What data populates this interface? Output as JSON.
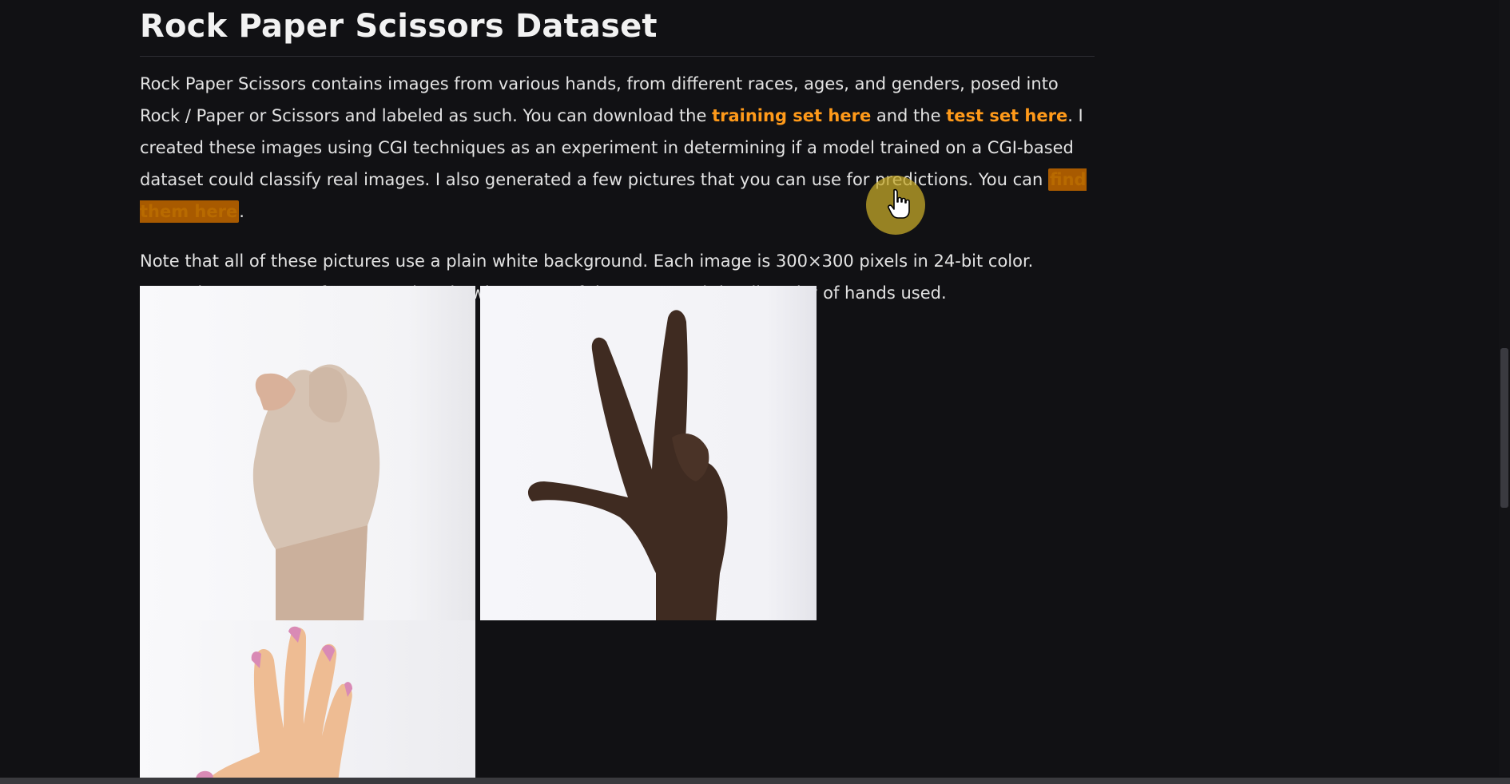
{
  "article": {
    "title": "Rock Paper Scissors Dataset",
    "para1": {
      "text_a": "Rock Paper Scissors contains images from various hands, from different races, ages, and genders, posed into Rock / Paper or Scissors and labeled as such. You can download the ",
      "link_training": "training set here",
      "text_b": " and the ",
      "link_test": "test set here",
      "text_c": ". I created these images using CGI techniques as an experiment in determining if a model trained on a CGI-based dataset could classify real images. I also generated a few pictures that you can use for predictions. You can ",
      "link_find": "find them here",
      "text_d": "."
    },
    "para2": "Note that all of these pictures use a plain white background. Each image is 300×300 pixels in 24-bit color. Examples Here are a few examples showing some of the poses and the diversity of hands used."
  },
  "colors": {
    "background": "#111114",
    "link": "#ff9a1a",
    "link_highlight_bg": "#a85a00",
    "cursor_halo": "#c4a828"
  },
  "icons": {
    "cursor": "hand-pointer-icon"
  },
  "images": [
    {
      "pose": "rock"
    },
    {
      "pose": "scissors"
    },
    {
      "pose": "paper"
    }
  ]
}
